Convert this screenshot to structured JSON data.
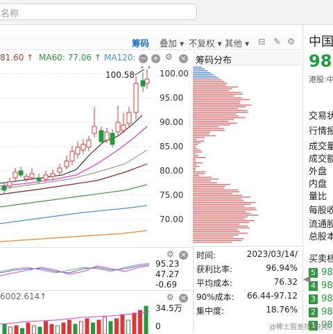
{
  "search": {
    "placeholder": "名称"
  },
  "toolbar": {
    "chip_tab": "筹码",
    "overlay": "叠加 ▾",
    "adjust": "不复权 ▾",
    "other": "其他 ▾"
  },
  "ma_legend": {
    "ma_prev": "81.60 ↑",
    "ma60": "MA60: 77.06 ↑",
    "ma120": "MA120:"
  },
  "price_axis": {
    "labels": [
      "100.00",
      "95.00",
      "90.00",
      "85.00",
      "80.00",
      "75.00",
      "70.00"
    ],
    "high_label": "100.58"
  },
  "chip": {
    "title": "筹码分布"
  },
  "stats": {
    "time_label": "时间:",
    "time_value": "2023/03/14/",
    "profit_label": "获利比率:",
    "profit_value": "96.94%",
    "avgcost_label": "平均成本:",
    "avgcost_value": "76.32",
    "cost90_label": "90%成本:",
    "cost90_value": "66.44-97.12",
    "concentration_label": "集中度:",
    "concentration_value": "18.76%"
  },
  "sub1": {
    "v1": "95.23",
    "v2": "47.27",
    "v3": "-0.69"
  },
  "sub2": {
    "header": "6002.614↑",
    "v1": "34.5万",
    "v2": "0"
  },
  "sidebar": {
    "name": "中国",
    "price": "98",
    "hk_label": "港股:中",
    "rows": [
      "交易状",
      "行情报",
      "成交量",
      "成交额",
      "外盘",
      "内盘",
      "量比",
      "每股收",
      "流通股",
      "总股本",
      "买卖档"
    ],
    "book_levels": [
      "5",
      "4",
      "3",
      "2",
      "1"
    ],
    "book_prices": [
      "98",
      "98",
      "98",
      "98",
      "98"
    ]
  },
  "watermark": "@稀土掘金技术社区",
  "colors": {
    "up": "#e03535",
    "down": "#1e9b3a",
    "accent": "#1a6fc9",
    "chip": "#e86a6a",
    "chip_blue": "#5b8ad8"
  }
}
